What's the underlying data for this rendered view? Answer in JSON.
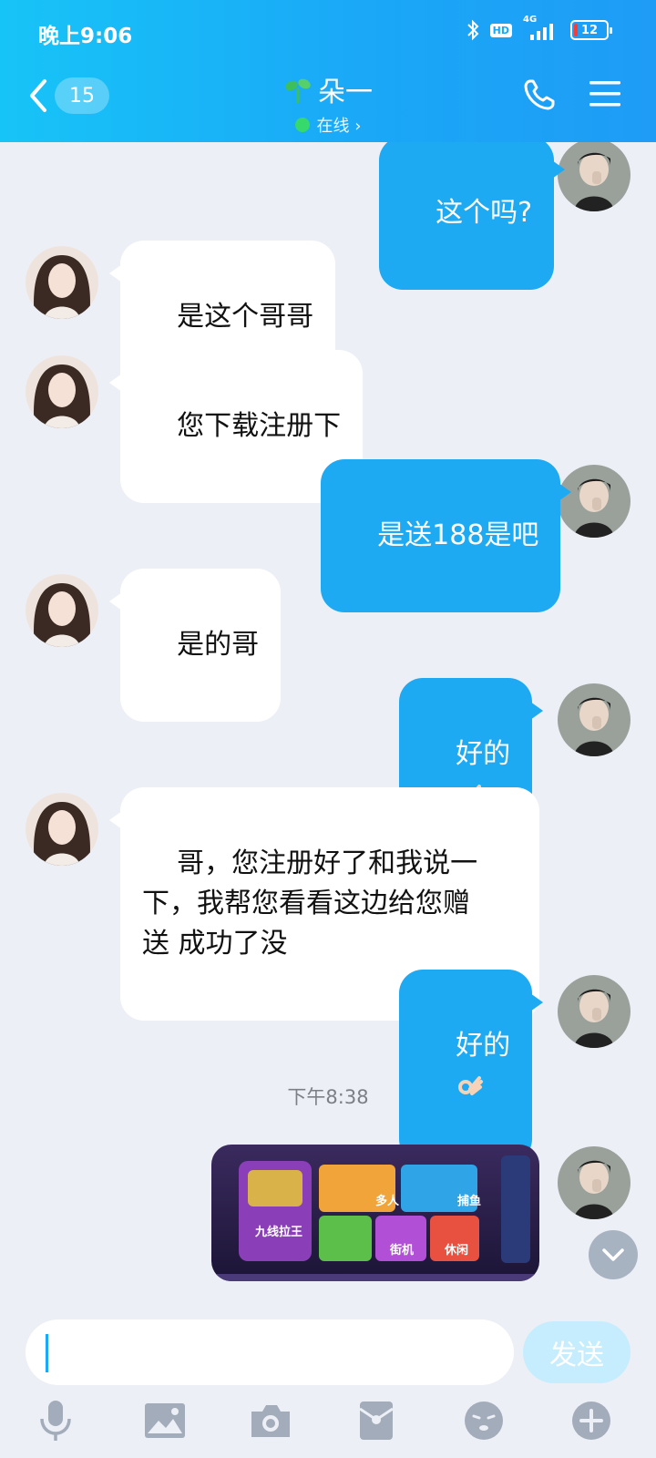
{
  "status_bar": {
    "time": "晚上9:06",
    "hd": "HD",
    "network": "4G",
    "battery": "12"
  },
  "header": {
    "unread_count": "15",
    "contact_name": "朵一",
    "presence": "在线 ›",
    "accent_color": "#1aa8f7",
    "online_color": "#37d86c"
  },
  "messages": [
    {
      "side": "out",
      "text": "这个吗?"
    },
    {
      "side": "in",
      "text": "是这个哥哥"
    },
    {
      "side": "in",
      "text": "您下载注册下"
    },
    {
      "side": "out",
      "text": "是送188是吧"
    },
    {
      "side": "in",
      "text": "是的哥"
    },
    {
      "side": "out",
      "text": "好的",
      "emoji": "ok-hand-emoji"
    },
    {
      "side": "in",
      "text": "哥，您注册好了和我说一\n下，我帮您看看这边给您赠\n送 成功了没"
    },
    {
      "side": "out",
      "text": "好的",
      "emoji": "ok-hand-emoji"
    }
  ],
  "timestamp": "下午8:38",
  "image_message": {
    "tiles": [
      "多人",
      "捕鱼",
      "街机",
      "休闲",
      "九线拉王"
    ]
  },
  "composer": {
    "value": "",
    "send_label": "发送"
  },
  "toolbar_icons": [
    "microphone-icon",
    "image-icon",
    "camera-icon",
    "red-packet-icon",
    "emoji-icon",
    "plus-icon"
  ]
}
